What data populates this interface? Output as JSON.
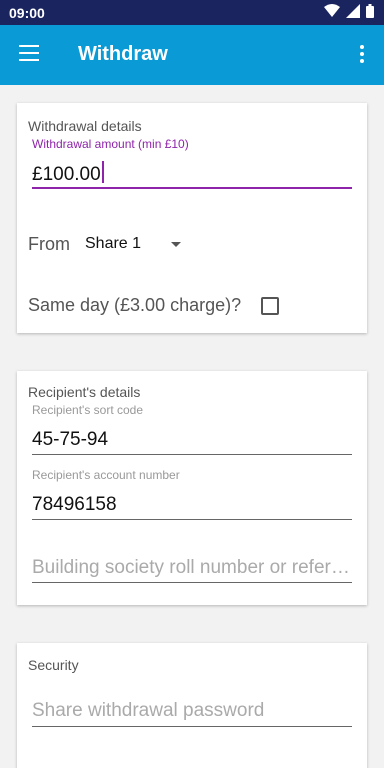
{
  "status_bar": {
    "time": "09:00"
  },
  "app_bar": {
    "title": "Withdraw"
  },
  "withdrawal": {
    "title": "Withdrawal details",
    "amount_label": "Withdrawal amount (min £10)",
    "amount_value": "£100.00",
    "from_label": "From",
    "from_selected": "Share 1",
    "same_day_label": "Same day (£3.00 charge)?",
    "same_day_checked": false
  },
  "recipient": {
    "title": "Recipient's details",
    "sort_code_label": "Recipient's sort code",
    "sort_code_value": "45-75-94",
    "account_label": "Recipient's account number",
    "account_value": "78496158",
    "reference_placeholder": "Building society roll number or reference"
  },
  "security": {
    "title": "Security",
    "password_placeholder": "Share withdrawal password"
  },
  "colors": {
    "status_bar": "#1a2560",
    "app_bar": "#0a9bd6",
    "accent": "#8e24aa"
  }
}
